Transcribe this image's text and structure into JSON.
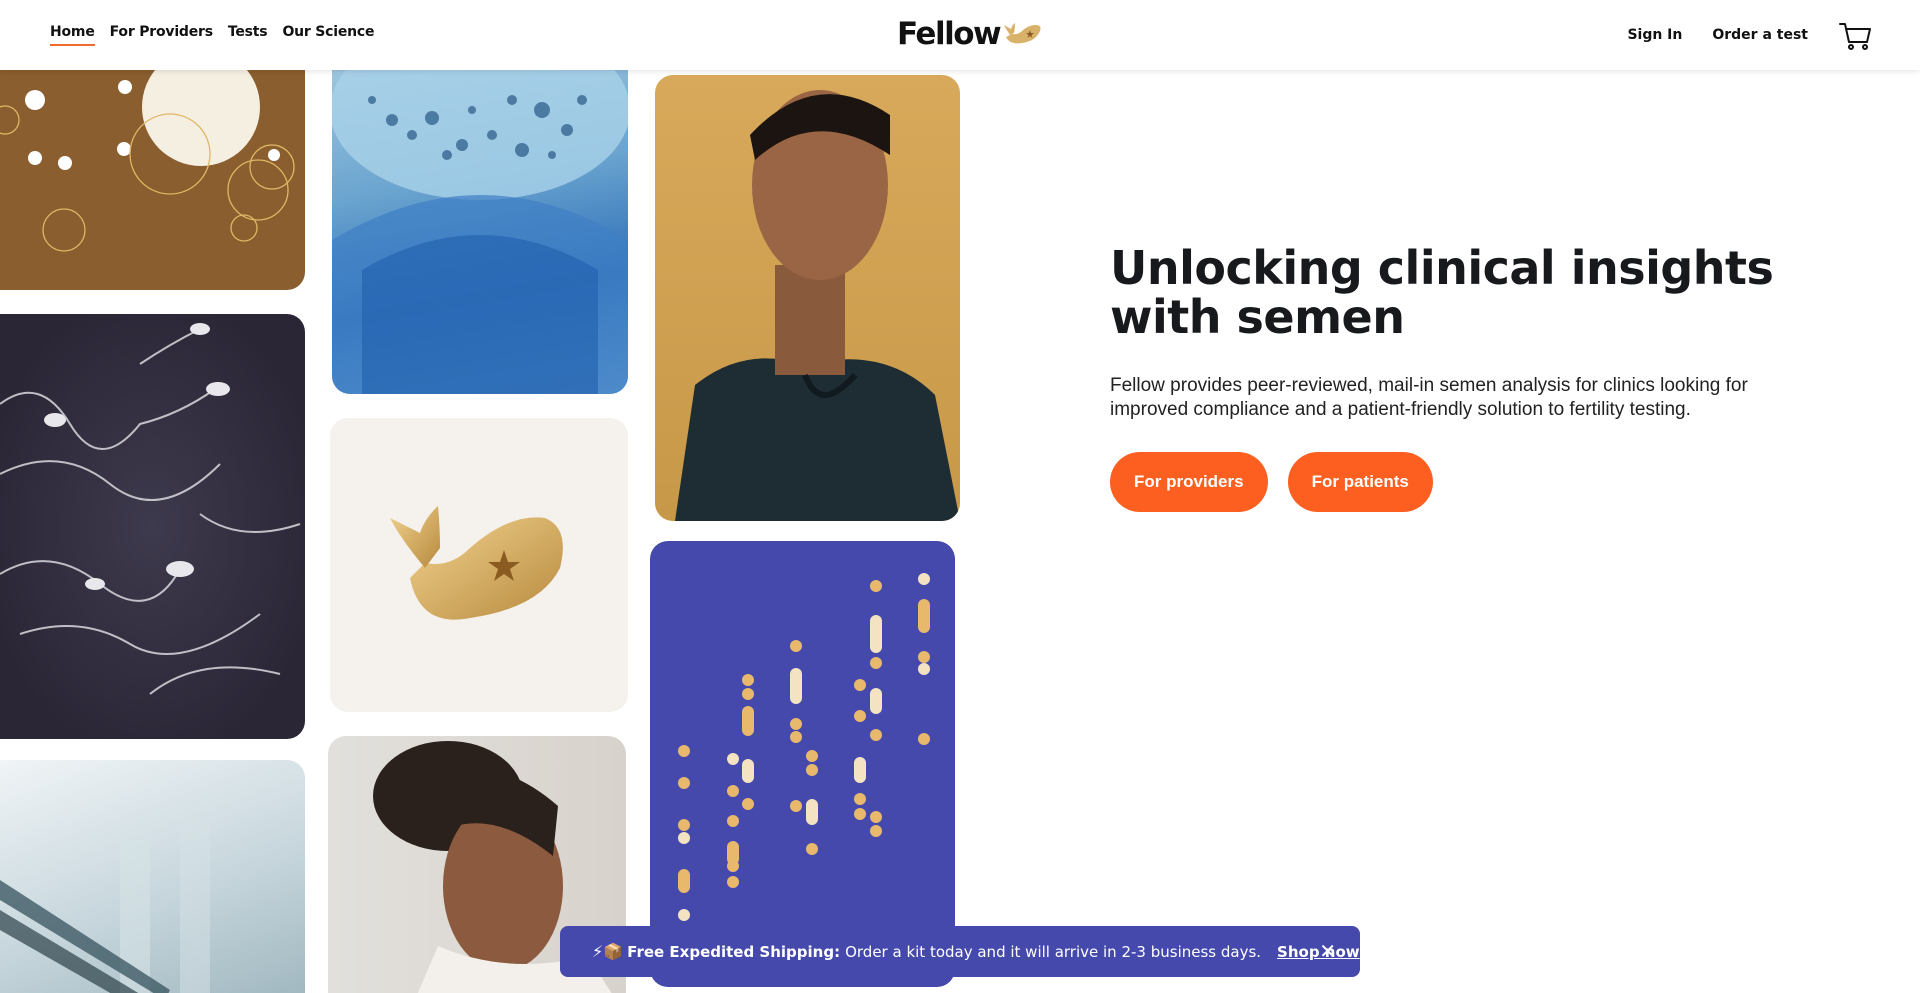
{
  "header": {
    "nav": [
      {
        "label": "Home",
        "active": true
      },
      {
        "label": "For Providers"
      },
      {
        "label": "Tests"
      },
      {
        "label": "Our Science"
      }
    ],
    "logo_text": "Fellow",
    "sign_in": "Sign In",
    "order": "Order a test",
    "cart_icon": "cart-icon"
  },
  "hero": {
    "title": "Unlocking clinical insights with semen",
    "body": "Fellow provides peer-reviewed, mail-in semen analysis for clinics looking for improved compliance and a patient-friendly solution to fertility testing.",
    "buttons": [
      "For providers",
      "For patients"
    ]
  },
  "banner": {
    "icons": "⚡📦",
    "strong": "Free Expedited Shipping:",
    "message": "Order a kit today and it will arrive in 2-3 business days.",
    "link": "Shop now",
    "close_icon": "close-icon"
  },
  "colors": {
    "accent": "#fc5f1f",
    "banner": "#4449ab",
    "nav_underline": "#f26a2e"
  }
}
